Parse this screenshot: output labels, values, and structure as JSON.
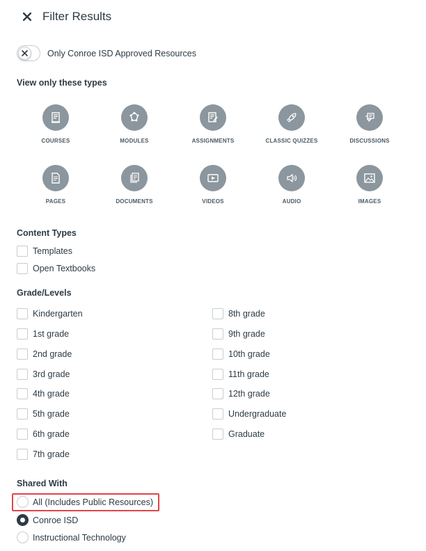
{
  "header": {
    "title": "Filter Results"
  },
  "toggle": {
    "label": "Only Conroe ISD Approved Resources",
    "on": false
  },
  "types": {
    "heading": "View only these types",
    "items": [
      {
        "label": "COURSES",
        "icon": "courses-icon"
      },
      {
        "label": "MODULES",
        "icon": "modules-icon"
      },
      {
        "label": "ASSIGNMENTS",
        "icon": "assignments-icon"
      },
      {
        "label": "CLASSIC QUIZZES",
        "icon": "rocket-icon"
      },
      {
        "label": "DISCUSSIONS",
        "icon": "discussions-icon"
      },
      {
        "label": "PAGES",
        "icon": "pages-icon"
      },
      {
        "label": "DOCUMENTS",
        "icon": "documents-icon"
      },
      {
        "label": "VIDEOS",
        "icon": "video-icon"
      },
      {
        "label": "AUDIO",
        "icon": "audio-icon"
      },
      {
        "label": "IMAGES",
        "icon": "image-icon"
      }
    ]
  },
  "content_types": {
    "heading": "Content Types",
    "items": [
      "Templates",
      "Open Textbooks"
    ]
  },
  "grades": {
    "heading": "Grade/Levels",
    "left": [
      "Kindergarten",
      "1st grade",
      "2nd grade",
      "3rd grade",
      "4th grade",
      "5th grade",
      "6th grade",
      "7th grade"
    ],
    "right": [
      "8th grade",
      "9th grade",
      "10th grade",
      "11th grade",
      "12th grade",
      "Undergraduate",
      "Graduate"
    ]
  },
  "shared_with": {
    "heading": "Shared With",
    "options": [
      {
        "label": "All (Includes Public Resources)",
        "selected": false
      },
      {
        "label": "Conroe ISD",
        "selected": true
      },
      {
        "label": "Instructional Technology",
        "selected": false
      }
    ]
  },
  "colors": {
    "icon_bg": "#8b969e",
    "text": "#2d3b45",
    "highlight": "#e0444a"
  }
}
